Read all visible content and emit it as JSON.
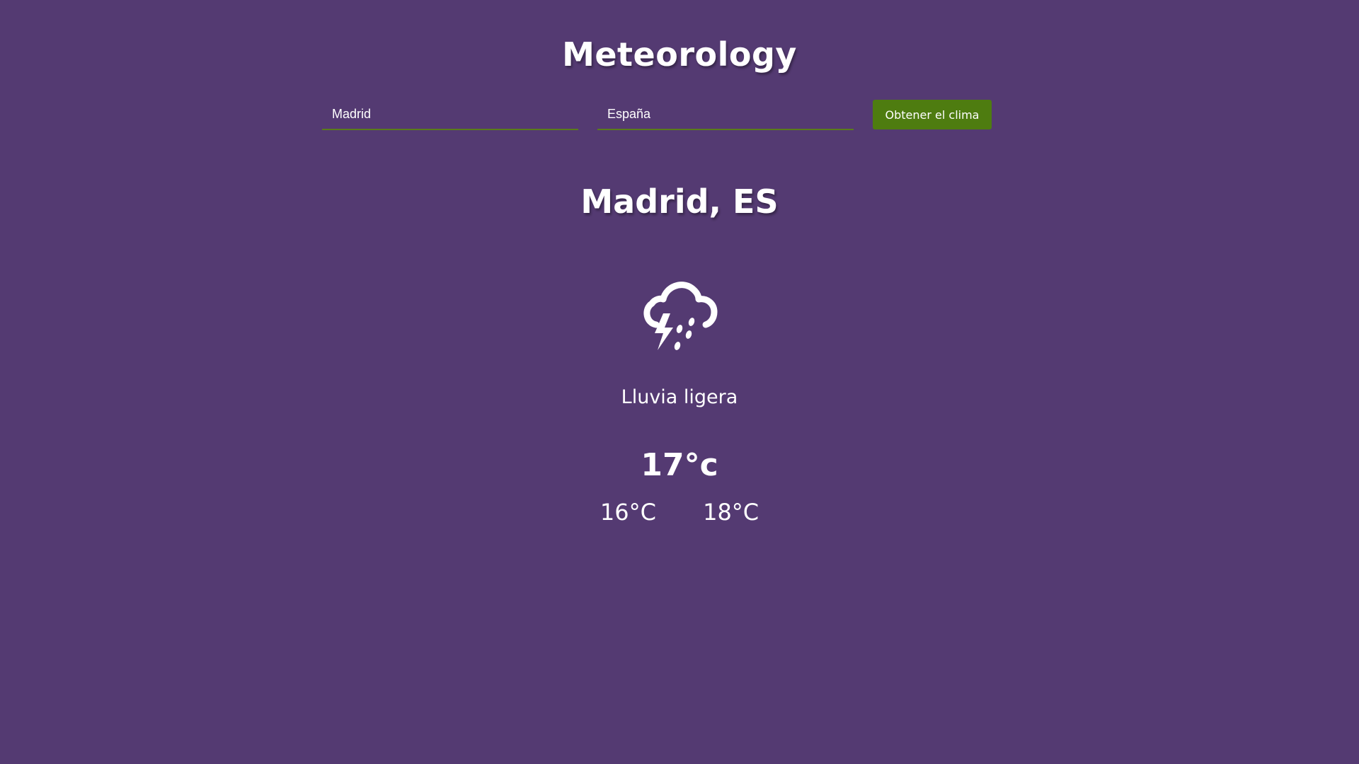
{
  "app": {
    "title": "Meteorology"
  },
  "search": {
    "city_value": "Madrid",
    "country_value": "España",
    "submit_label": "Obtener el clima"
  },
  "weather": {
    "location": "Madrid, ES",
    "icon": "thunderstorm-rain-icon",
    "description": "Lluvia ligera",
    "current_temp": "17°c",
    "temp_min": "16°C",
    "temp_max": "18°C"
  },
  "colors": {
    "background": "#543a72",
    "accent": "#4e7c10",
    "text": "#ffffff"
  }
}
